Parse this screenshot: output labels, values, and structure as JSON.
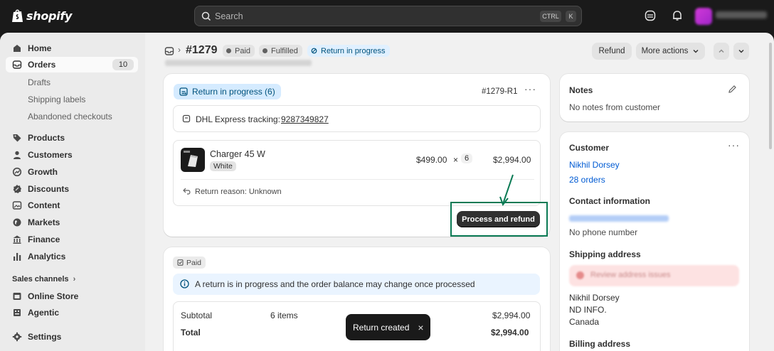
{
  "brand": {
    "name": "shopify"
  },
  "search": {
    "placeholder": "Search",
    "shortcut_ctrl": "CTRL",
    "shortcut_key": "K"
  },
  "sidebar": {
    "items": [
      {
        "label": "Home",
        "icon": "home-icon"
      },
      {
        "label": "Orders",
        "icon": "orders-icon",
        "badge": "10",
        "active": true
      },
      {
        "label": "Products",
        "icon": "tag-icon"
      },
      {
        "label": "Customers",
        "icon": "person-icon"
      },
      {
        "label": "Growth",
        "icon": "growth-icon"
      },
      {
        "label": "Discounts",
        "icon": "discount-icon"
      },
      {
        "label": "Content",
        "icon": "content-icon"
      },
      {
        "label": "Markets",
        "icon": "globe-icon"
      },
      {
        "label": "Finance",
        "icon": "bank-icon"
      },
      {
        "label": "Analytics",
        "icon": "chart-icon"
      }
    ],
    "order_subitems": [
      "Drafts",
      "Shipping labels",
      "Abandoned checkouts"
    ],
    "sales_channels_label": "Sales channels",
    "channels": [
      {
        "label": "Online Store",
        "icon": "store-icon"
      },
      {
        "label": "Agentic",
        "icon": "agentic-icon"
      }
    ],
    "settings_label": "Settings"
  },
  "header": {
    "order_number": "#1279",
    "status_paid": "Paid",
    "status_fulfilled": "Fulfilled",
    "status_return": "Return in progress",
    "refund_label": "Refund",
    "more_actions_label": "More actions"
  },
  "return_card": {
    "badge": "Return in progress (6)",
    "return_id": "#1279-R1",
    "tracking_label": "DHL Express tracking:",
    "tracking_number": "9287349827",
    "product_name": "Charger 45 W",
    "variant": "White",
    "unit_price": "$499.00",
    "times": "×",
    "quantity": "6",
    "line_total": "$2,994.00",
    "return_reason": "Return reason: Unknown",
    "process_button": "Process and refund"
  },
  "payment_card": {
    "badge": "Paid",
    "info_banner": "A return is in progress and the order balance may change once processed",
    "subtotal_label": "Subtotal",
    "subtotal_items": "6 items",
    "subtotal_value": "$2,994.00",
    "total_label": "Total",
    "total_value": "$2,994.00"
  },
  "notes": {
    "title": "Notes",
    "body": "No notes from customer"
  },
  "customer": {
    "title": "Customer",
    "name": "Nikhil Dorsey",
    "orders": "28 orders",
    "contact_title": "Contact information",
    "phone": "No phone number",
    "shipping_title": "Shipping address",
    "address_alert": "Review address issues",
    "address_lines": [
      "Nikhil Dorsey",
      "ND INFO.",
      "Canada"
    ],
    "billing_title": "Billing address"
  },
  "toast": {
    "message": "Return created",
    "close": "×"
  },
  "colors": {
    "accent_link": "#005bd3",
    "highlight_border": "#0a7a54",
    "topbar": "#1a1a1a"
  }
}
